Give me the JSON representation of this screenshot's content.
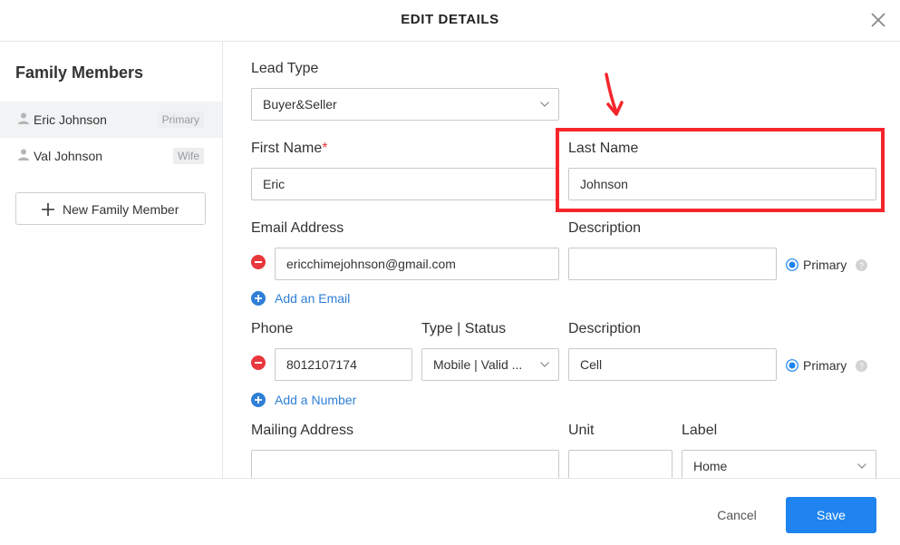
{
  "header": {
    "title": "EDIT DETAILS",
    "close_icon": "close-icon"
  },
  "sidebar": {
    "title": "Family Members",
    "members": [
      {
        "name": "Eric Johnson",
        "badge": "Primary",
        "icon": "person-icon",
        "selected": true
      },
      {
        "name": "Val Johnson",
        "badge": "Wife",
        "icon": "person-icon",
        "selected": false
      }
    ],
    "new_member_label": "New Family Member"
  },
  "form": {
    "lead_type": {
      "label": "Lead Type",
      "value": "Buyer&Seller"
    },
    "first_name": {
      "label": "First Name",
      "required_mark": "*",
      "value": "Eric"
    },
    "last_name": {
      "label": "Last Name",
      "value": "Johnson"
    },
    "email": {
      "label": "Email Address",
      "value": "ericchimejohnson@gmail.com",
      "description_label": "Description",
      "description_value": "",
      "primary_label": "Primary",
      "add_label": "Add an Email"
    },
    "phone": {
      "label": "Phone",
      "value": "8012107174",
      "type_label": "Type | Status",
      "type_value": "Mobile | Valid ...",
      "description_label": "Description",
      "description_value": "Cell",
      "primary_label": "Primary",
      "add_label": "Add a Number"
    },
    "mailing": {
      "label": "Mailing Address",
      "value": "",
      "unit_label": "Unit",
      "unit_value": "",
      "label_label": "Label",
      "label_value": "Home"
    }
  },
  "footer": {
    "cancel_label": "Cancel",
    "save_label": "Save"
  },
  "colors": {
    "accent": "#1f84ef",
    "annotation": "#f5262b",
    "remove": "#e8383d",
    "link": "#2f7fd6"
  }
}
